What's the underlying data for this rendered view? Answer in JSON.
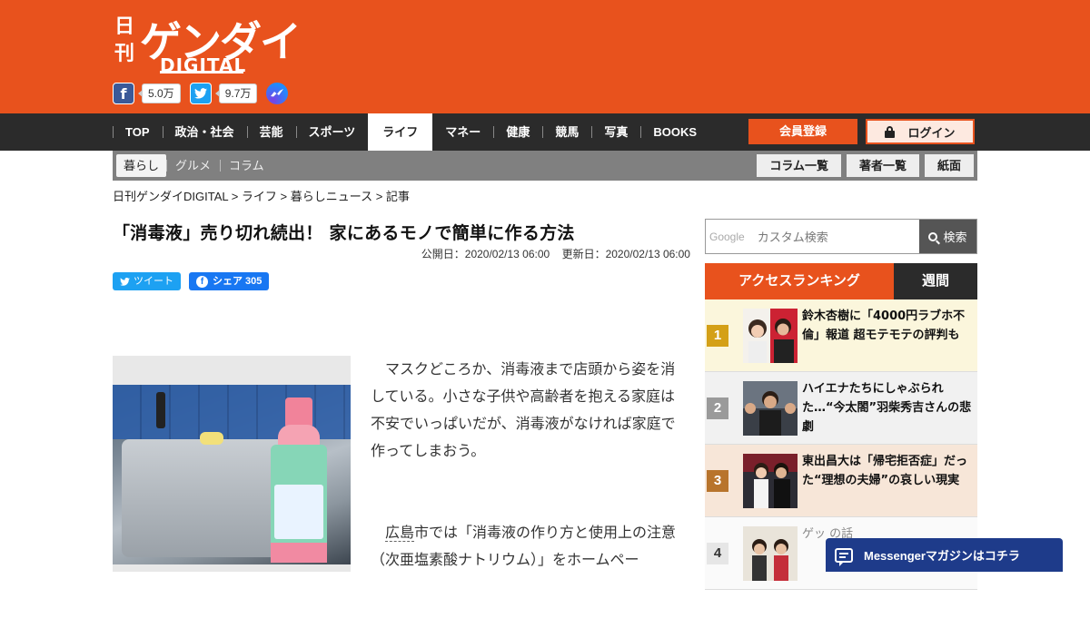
{
  "logo": {
    "kanji_left": "日刊",
    "katakana": "ゲンダイ",
    "digital": "DIGITAL"
  },
  "social": {
    "facebook_count": "5.0万",
    "twitter_count": "9.7万"
  },
  "nav": {
    "items": [
      "TOP",
      "政治・社会",
      "芸能",
      "スポーツ",
      "ライフ",
      "マネー",
      "健康",
      "競馬",
      "写真",
      "BOOKS"
    ],
    "active": "ライフ",
    "register_label": "会員登録",
    "login_label": "ログイン"
  },
  "subnav": {
    "items": [
      "暮らし",
      "グルメ",
      "コラム"
    ],
    "right": [
      "コラム一覧",
      "著者一覧",
      "紙面"
    ]
  },
  "breadcrumb": "日刊ゲンダイDIGITAL > ライフ > 暮らしニュース > 記事",
  "article": {
    "title": "「消毒液」売り切れ続出！ 家にあるモノで簡単に作る方法",
    "published": "公開日：2020/02/13 06:00",
    "updated": "更新日：2020/02/13 06:00",
    "tweet_label": "ツイート",
    "share_label": "シェア 305",
    "paragraph1": "マスクどころか、消毒液まで店頭から姿を消している。小さな子供や高齢者を抱える家庭は不安でいっぱいだが、消毒液がなければ家庭で作ってしまおう。",
    "paragraph2_link": "広島",
    "paragraph2_rest": "市では「消毒液の作り方と使用上の注意（次亜塩素酸ナトリウム）」をホームペー"
  },
  "search": {
    "brand": "Google",
    "placeholder": "カスタム検索",
    "button": "検索"
  },
  "ranking": {
    "tab_access": "アクセスランキング",
    "tab_week": "週間",
    "items": [
      {
        "rank": "1",
        "text": "鈴木杏樹に「4000円ラブホ不倫」報道 超モテモテの評判も"
      },
      {
        "rank": "2",
        "text": "ハイエナたちにしゃぶられた…“今太閤”羽柴秀吉さんの悲劇"
      },
      {
        "rank": "3",
        "text": "東出昌大は「帰宅拒否症」だった“理想の夫婦”の哀しい現実"
      },
      {
        "rank": "4",
        "text": "ゲッ の話"
      }
    ]
  },
  "messenger_label": "Messengerマガジンはコチラ",
  "colors": {
    "brand_orange": "#e8521d",
    "nav_dark": "#2b2b2b",
    "rank1": "#d4a017",
    "rank2": "#9a9a9a",
    "rank3": "#b8742c",
    "messenger": "#1e3b8a"
  }
}
